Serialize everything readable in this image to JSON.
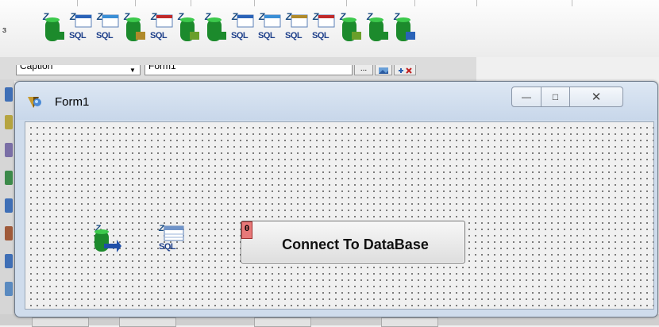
{
  "palette": {
    "left_mark": "ɜ",
    "icons": [
      {
        "name": "zconnection-icon",
        "sql": ""
      },
      {
        "name": "zquery-icon",
        "sql": "SQL"
      },
      {
        "name": "zreadonly-query-icon",
        "sql": "SQL"
      },
      {
        "name": "ztable-icon",
        "sql": ""
      },
      {
        "name": "zupdate-sql-icon",
        "sql": "SQL"
      },
      {
        "name": "zstored-proc-icon",
        "sql": ""
      },
      {
        "name": "zsql-processor-icon",
        "sql": ""
      },
      {
        "name": "zsql-monitor-icon",
        "sql": "SQL"
      },
      {
        "name": "zsql-metadata-icon",
        "sql": "SQL"
      },
      {
        "name": "zsql-editor-icon",
        "sql": "SQL"
      },
      {
        "name": "zsql-display-icon",
        "sql": "SQL"
      },
      {
        "name": "zsequence-icon",
        "sql": ""
      },
      {
        "name": "zib-event-alerter-icon",
        "sql": ""
      },
      {
        "name": "zpg-event-alerter-icon",
        "sql": ""
      }
    ]
  },
  "inspector": {
    "property": "Caption",
    "value": "Form1",
    "ellipsis": "..."
  },
  "form": {
    "title": "Form1",
    "minimize_glyph": "—",
    "maximize_glyph": "□",
    "close_glyph": "✕",
    "connect_button_label": "Connect To DataBase",
    "badge_text": "0",
    "component_query_sql": "SQL"
  },
  "colors": {
    "titlebar": "#cfdcec",
    "client": "#f0f0f0",
    "badge": "#e87979"
  }
}
